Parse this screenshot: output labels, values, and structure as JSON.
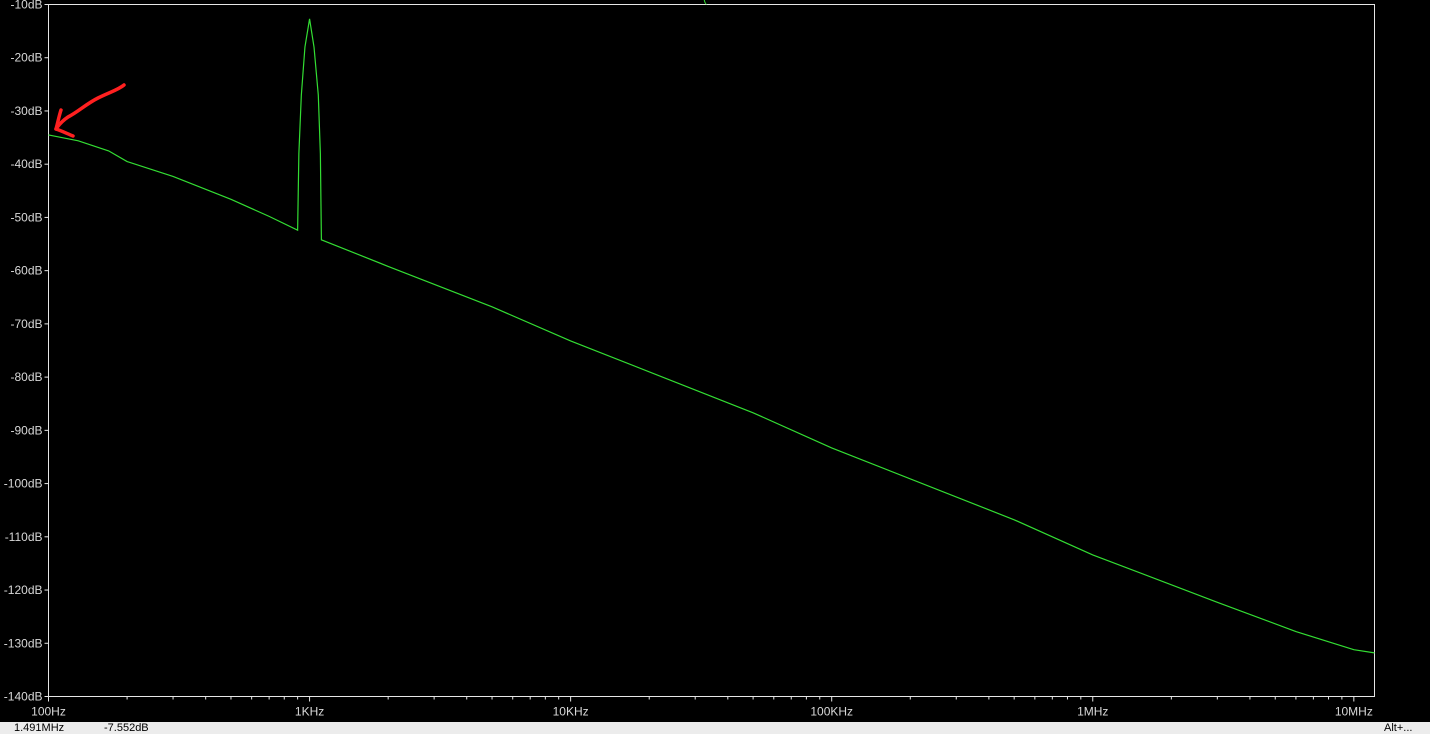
{
  "chart_data": {
    "type": "line",
    "title": "",
    "xlabel": "",
    "ylabel": "",
    "x_scale": "log",
    "xlim": [
      100,
      12000000
    ],
    "ylim": [
      -140,
      -10
    ],
    "grid": false,
    "x_ticks": [
      {
        "value": 100,
        "label": "100Hz"
      },
      {
        "value": 1000,
        "label": "1KHz"
      },
      {
        "value": 10000,
        "label": "10KHz"
      },
      {
        "value": 100000,
        "label": "100KHz"
      },
      {
        "value": 1000000,
        "label": "1MHz"
      },
      {
        "value": 10000000,
        "label": "10MHz"
      }
    ],
    "y_ticks": [
      {
        "value": -10,
        "label": "-10dB"
      },
      {
        "value": -20,
        "label": "-20dB"
      },
      {
        "value": -30,
        "label": "-30dB"
      },
      {
        "value": -40,
        "label": "-40dB"
      },
      {
        "value": -50,
        "label": "-50dB"
      },
      {
        "value": -60,
        "label": "-60dB"
      },
      {
        "value": -70,
        "label": "-70dB"
      },
      {
        "value": -80,
        "label": "-80dB"
      },
      {
        "value": -90,
        "label": "-90dB"
      },
      {
        "value": -100,
        "label": "-100dB"
      },
      {
        "value": -110,
        "label": "-110dB"
      },
      {
        "value": -130,
        "label": "-130dB"
      },
      {
        "value": -120,
        "label": "-120dB"
      },
      {
        "value": -140,
        "label": "-140dB"
      }
    ],
    "series": [
      {
        "color": "#33dd33",
        "points": [
          [
            100,
            -34.5
          ],
          [
            130,
            -35.6
          ],
          [
            170,
            -37.5
          ],
          [
            200,
            -39.5
          ],
          [
            300,
            -42.3
          ],
          [
            500,
            -46.6
          ],
          [
            700,
            -49.8
          ],
          [
            900,
            -52.4
          ],
          [
            910,
            -38
          ],
          [
            930,
            -27
          ],
          [
            960,
            -18
          ],
          [
            1000,
            -12.7
          ],
          [
            1040,
            -18
          ],
          [
            1080,
            -27
          ],
          [
            1100,
            -38
          ],
          [
            1110,
            -54.2
          ],
          [
            2000,
            -59.2
          ],
          [
            5000,
            -66.8
          ],
          [
            10000,
            -73.2
          ],
          [
            50000,
            -86.7
          ],
          [
            100000,
            -93.3
          ],
          [
            500000,
            -106.8
          ],
          [
            1000000,
            -113.4
          ],
          [
            3000000,
            -122.3
          ],
          [
            6000000,
            -127.8
          ],
          [
            10000000,
            -131.2
          ],
          [
            12000000,
            -131.8
          ]
        ]
      }
    ],
    "annotations": [
      {
        "type": "arrow",
        "color": "#ff2020",
        "target": [
          100,
          -34
        ]
      }
    ]
  },
  "status_bar": {
    "cursor_x": "1.491MHz",
    "cursor_y": "-7.552dB",
    "right_text": "Alt+..."
  }
}
